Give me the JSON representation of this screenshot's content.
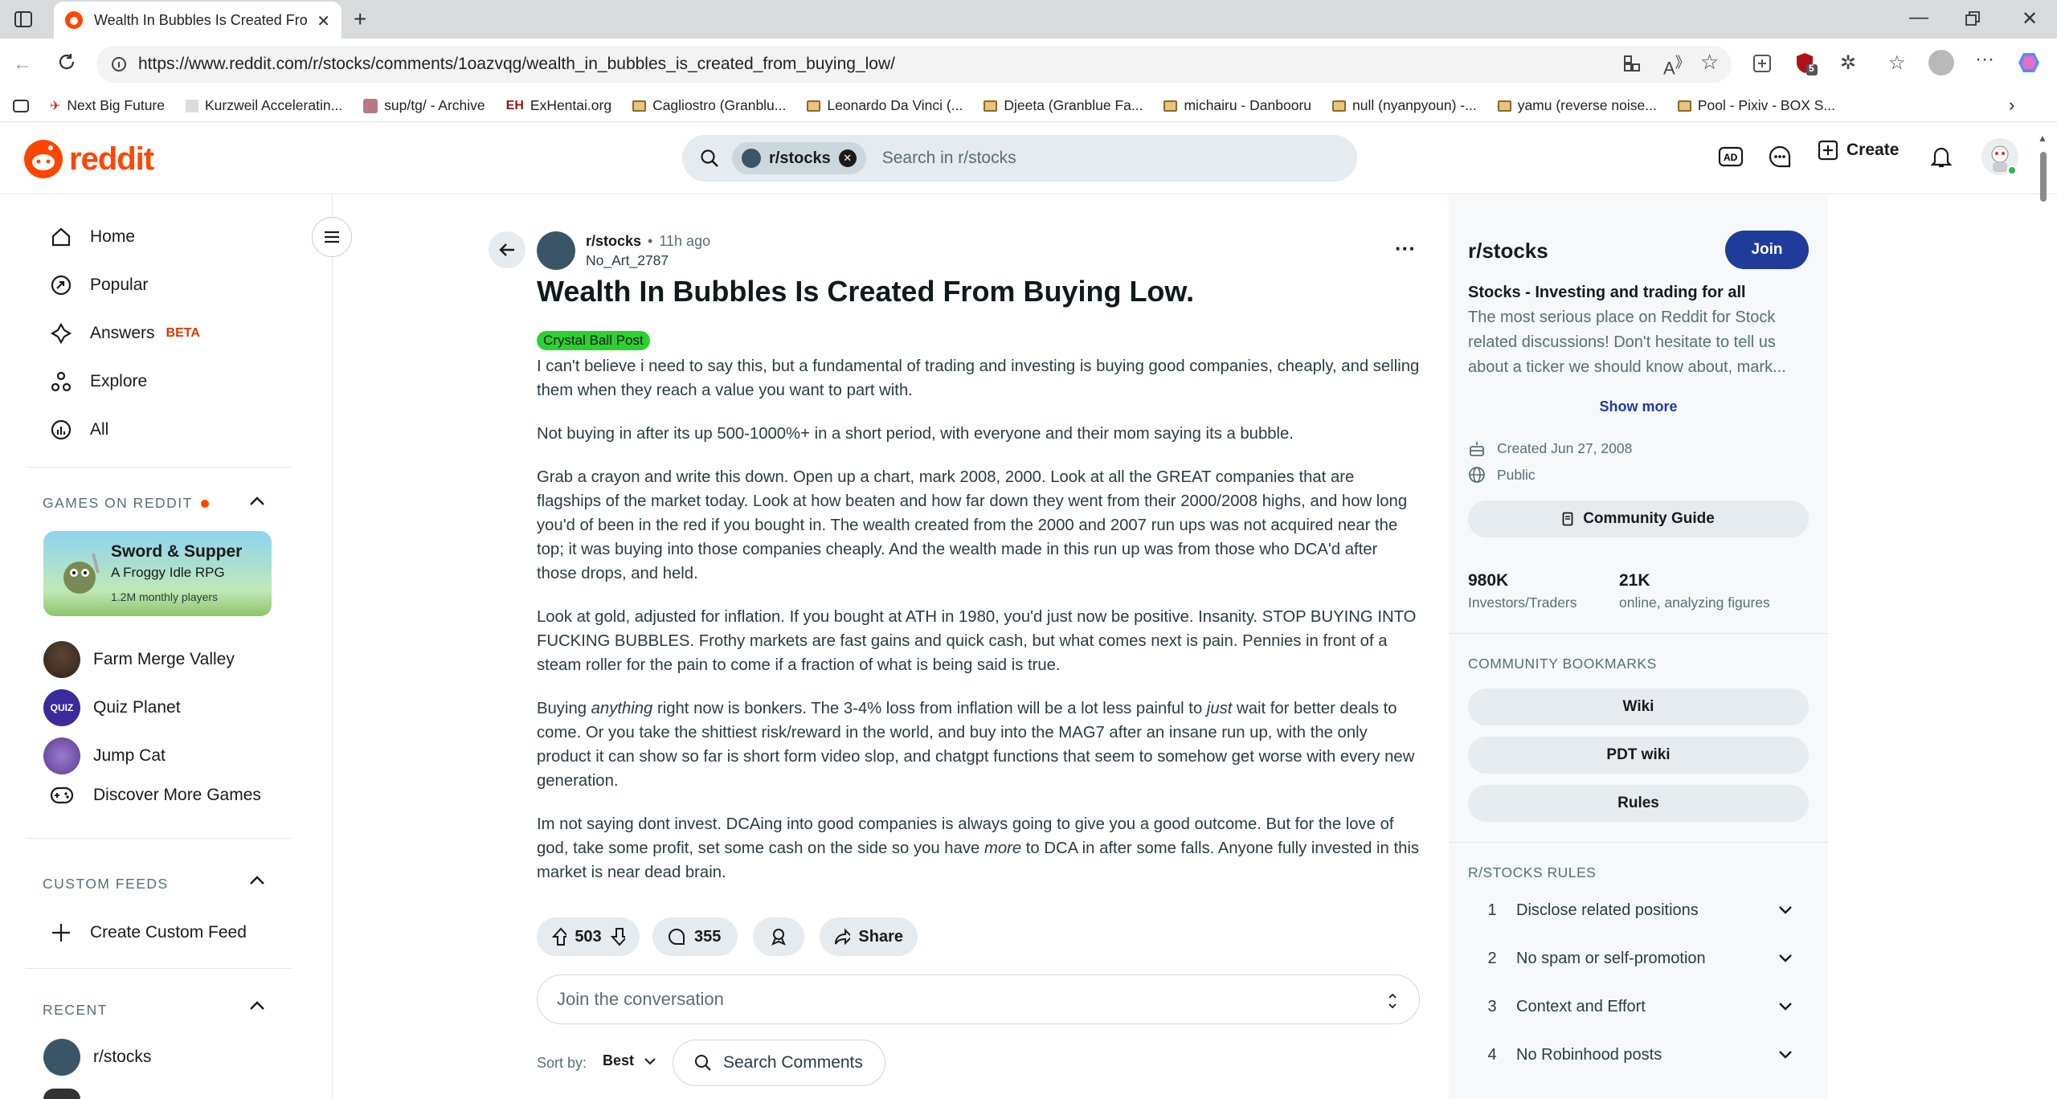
{
  "browser": {
    "tab_title": "Wealth In Bubbles Is Created From Buying Low.",
    "url": "https://www.reddit.com/r/stocks/comments/1oazvqg/wealth_in_bubbles_is_created_from_buying_low/",
    "ext_badge": "5",
    "bookmarks": [
      "Next Big Future",
      "Kurzweil Acceleratin...",
      "sup/tg/ - Archive",
      "ExHentai.org",
      "Cagliostro (Granblu...",
      "Leonardo Da Vinci (...",
      "Djeeta (Granblue Fa...",
      "michairu - Danbooru",
      "null (nyanpyoun) -...",
      "yamu (reverse noise...",
      "Pool - Pixiv - BOX S..."
    ]
  },
  "header": {
    "logo": "reddit",
    "search_chip": "r/stocks",
    "search_placeholder": "Search in r/stocks",
    "create_label": "Create"
  },
  "sidebar": {
    "nav": [
      "Home",
      "Popular",
      "Answers",
      "Explore",
      "All"
    ],
    "answers_badge": "BETA",
    "games_title": "GAMES ON REDDIT",
    "featured_game": {
      "title": "Sword & Supper",
      "subtitle": "A Froggy Idle RPG",
      "players": "1.2M monthly players"
    },
    "games": [
      "Farm Merge Valley",
      "Quiz Planet",
      "Jump Cat",
      "Discover More Games"
    ],
    "custom_feeds_title": "CUSTOM FEEDS",
    "create_custom_feed": "Create Custom Feed",
    "recent_title": "RECENT",
    "recent": [
      "r/stocks"
    ]
  },
  "post": {
    "subreddit": "r/stocks",
    "time": "11h ago",
    "author": "No_Art_2787",
    "title": "Wealth In Bubbles Is Created From Buying Low.",
    "flair": "Crystal Ball Post",
    "paragraphs": [
      "I can't believe i need to say this, but a fundamental of trading and investing is buying good companies, cheaply, and selling them when they reach a value you want to part with.",
      "Not buying in after its up 500-1000%+ in a short period, with everyone and their mom saying its a bubble.",
      "Grab a crayon and write this down. Open up a chart, mark 2008, 2000. Look at all the GREAT companies that are flagships of the market today. Look at how beaten and how far down they went from their 2000/2008 highs, and how long you'd of been in the red if you bought in. The wealth created from the 2000 and 2007 run ups was not acquired near the top; it was buying into those companies cheaply. And the wealth made in this run up was from those who DCA'd after those drops, and held.",
      "Look at gold, adjusted for inflation. If you bought at ATH in 1980, you'd just now be positive. Insanity. STOP BUYING INTO FUCKING BUBBLES. Frothy markets are fast gains and quick cash, but what comes next is pain. Pennies in front of a steam roller for the pain to come if a fraction of what is being said is true."
    ],
    "p5": {
      "a": "Buying ",
      "em1": "anything",
      "b": " right now is bonkers. The 3-4% loss from inflation will be a lot less painful to ",
      "em2": "just",
      "c": " wait for better deals to come. Or you take the shittiest risk/reward in the world, and buy into the MAG7 after an insane run up, with the only product it can show so far is short form video slop, and chatgpt functions that seem to somehow get worse with every new generation."
    },
    "p6": {
      "a": "Im not saying dont invest. DCAing into good companies is always going to give you a good outcome. But for the love of god, take some profit, set some cash on the side so you have ",
      "em": "more",
      "b": " to DCA in after some falls. Anyone fully invested in this market is near dead brain."
    },
    "votes": "503",
    "comments": "355",
    "share": "Share",
    "join_placeholder": "Join the conversation",
    "sort_label": "Sort by:",
    "sort_value": "Best",
    "search_comments": "Search Comments"
  },
  "community": {
    "name": "r/stocks",
    "join": "Join",
    "tagline": "Stocks - Investing and trading for all",
    "description": "The most serious place on Reddit for Stock related discussions! Don't hesitate to tell us about a ticker we should know about, mark...",
    "show_more": "Show more",
    "created": "Created Jun 27, 2008",
    "visibility": "Public",
    "guide": "Community Guide",
    "members": "980K",
    "members_label": "Investors/Traders",
    "online": "21K",
    "online_label": "online, analyzing figures",
    "bookmarks_title": "COMMUNITY BOOKMARKS",
    "bookmarks": [
      "Wiki",
      "PDT wiki",
      "Rules"
    ],
    "rules_title": "R/STOCKS RULES",
    "rules": [
      {
        "n": "1",
        "t": "Disclose related positions"
      },
      {
        "n": "2",
        "t": "No spam or self-promotion"
      },
      {
        "n": "3",
        "t": "Context and Effort"
      },
      {
        "n": "4",
        "t": "No Robinhood posts"
      }
    ]
  }
}
